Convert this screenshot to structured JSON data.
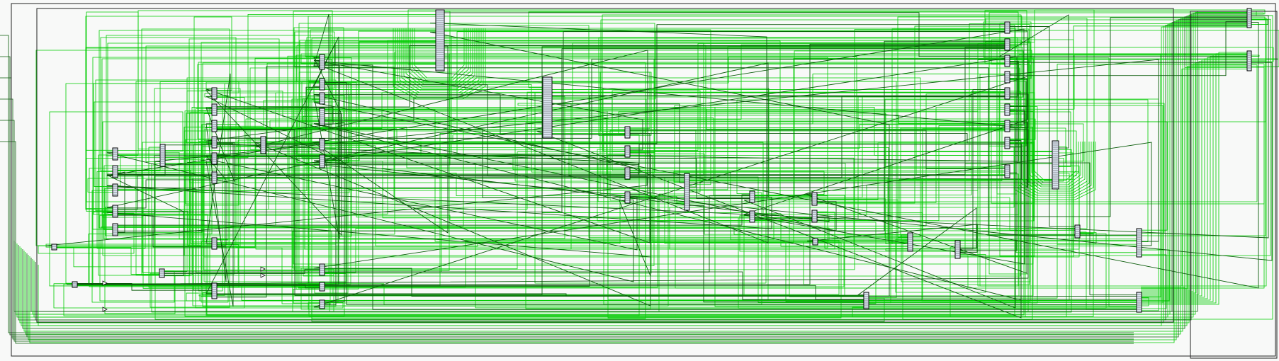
{
  "view": {
    "kind": "schematic-netlist",
    "background_color": "#f8f9f8",
    "wire_color_primary": "#00cc00",
    "wire_color_secondary": "#0a5c0a",
    "frame_color": "#000000",
    "cell_fill": "#dde6f2",
    "cell_stroke": "#000000"
  },
  "cells": [
    {
      "id": "c-top-center"
    },
    {
      "id": "c-mid-big"
    },
    {
      "id": "c-right-big"
    },
    {
      "id": "c-ra1"
    },
    {
      "id": "c-ra2"
    },
    {
      "id": "c-ra3"
    },
    {
      "id": "c-ra4"
    },
    {
      "id": "c-ra5"
    },
    {
      "id": "c-ra6"
    },
    {
      "id": "c-ra7"
    },
    {
      "id": "c-ra8"
    },
    {
      "id": "c-ra9"
    }
  ]
}
